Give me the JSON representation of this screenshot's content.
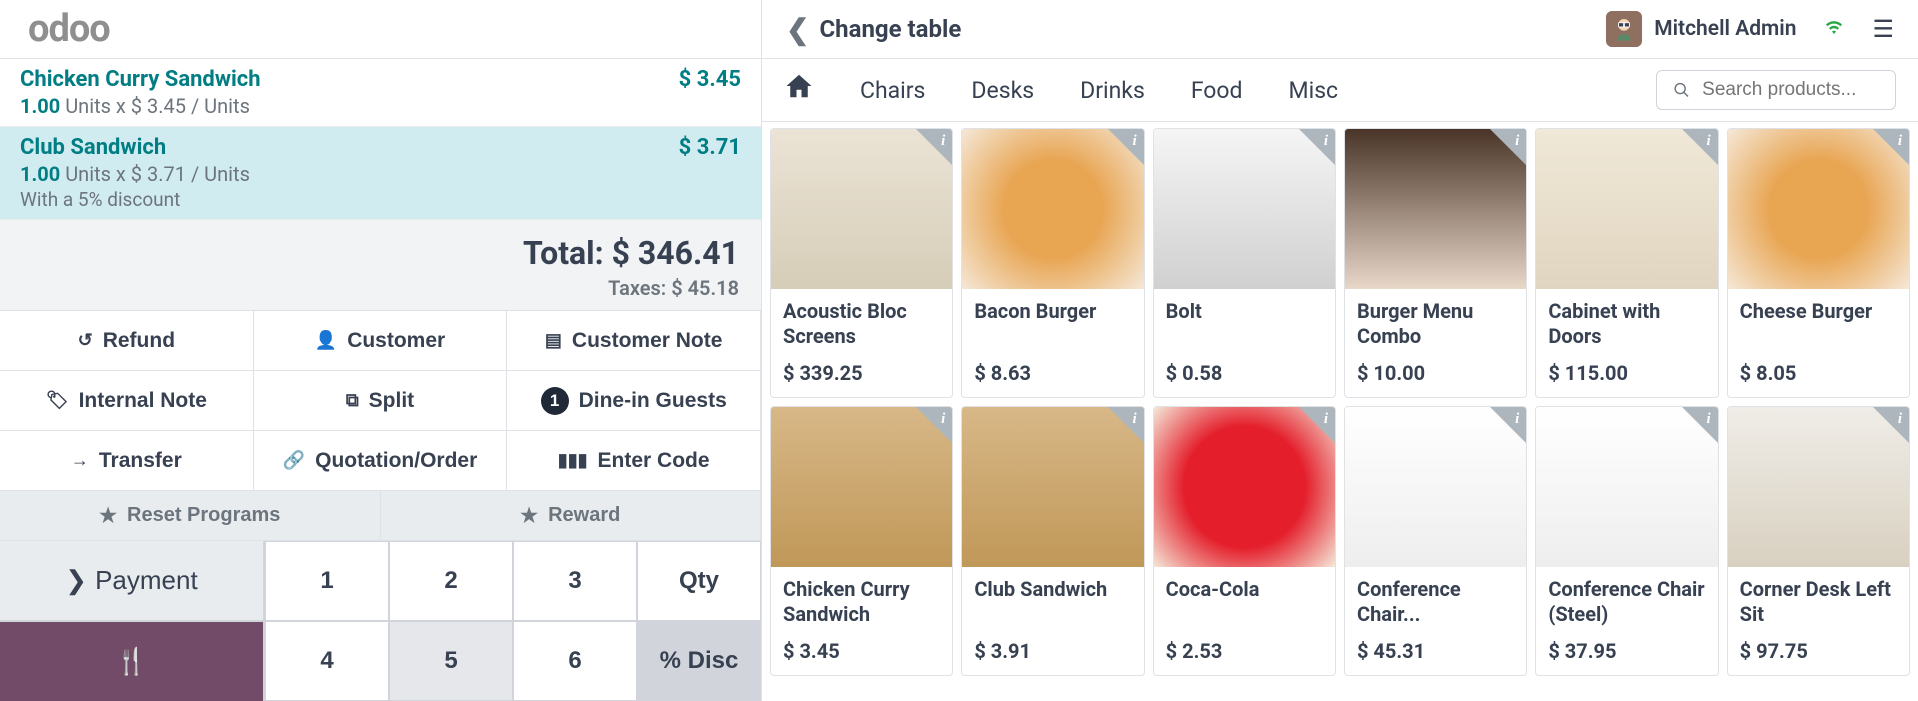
{
  "logo": "odoo",
  "order_lines": [
    {
      "name": "Chicken Curry Sandwich",
      "price": "$ 3.45",
      "qty_bold": "1.00",
      "qty_rest": "Units x $ 3.45 / Units",
      "discount": "",
      "selected": false
    },
    {
      "name": "Club Sandwich",
      "price": "$ 3.71",
      "qty_bold": "1.00",
      "qty_rest": "Units x $ 3.71 / Units",
      "discount": "With a 5% discount",
      "selected": true
    }
  ],
  "totals": {
    "label": "Total: $ 346.41",
    "taxes": "Taxes: $ 45.18"
  },
  "actions": {
    "refund": "Refund",
    "customer": "Customer",
    "customer_note": "Customer Note",
    "internal_note": "Internal Note",
    "split": "Split",
    "guests_badge": "1",
    "guests_label": "Dine-in Guests",
    "transfer": "Transfer",
    "quotation": "Quotation/Order",
    "enter_code": "Enter Code"
  },
  "programs": {
    "reset": "Reset Programs",
    "reward": "Reward"
  },
  "payment": "Payment",
  "numpad": {
    "n1": "1",
    "n2": "2",
    "n3": "3",
    "qty": "Qty",
    "n4": "4",
    "n5": "5",
    "n6": "6",
    "disc": "% Disc"
  },
  "header": {
    "back": "Change table",
    "user": "Mitchell Admin"
  },
  "categories": [
    "Chairs",
    "Desks",
    "Drinks",
    "Food",
    "Misc"
  ],
  "search_placeholder": "Search products...",
  "products_row1": [
    {
      "name": "Acoustic Bloc Screens",
      "price": "$ 339.25",
      "cls": "p-screen"
    },
    {
      "name": "Bacon Burger",
      "price": "$ 8.63",
      "cls": "p-burger"
    },
    {
      "name": "Bolt",
      "price": "$ 0.58",
      "cls": "p-bolt"
    },
    {
      "name": "Burger Menu Combo",
      "price": "$ 10.00",
      "cls": "p-combo"
    },
    {
      "name": "Cabinet with Doors",
      "price": "$ 115.00",
      "cls": "p-cabinet"
    },
    {
      "name": "Cheese Burger",
      "price": "$ 8.05",
      "cls": "p-burger"
    }
  ],
  "products_row2": [
    {
      "name": "Chicken Curry Sandwich",
      "price": "$ 3.45",
      "cls": "p-sandwich"
    },
    {
      "name": "Club Sandwich",
      "price": "$ 3.91",
      "cls": "p-sandwich"
    },
    {
      "name": "Coca-Cola",
      "price": "$ 2.53",
      "cls": "p-coke"
    },
    {
      "name": "Conference Chair...",
      "price": "$ 45.31",
      "cls": "p-chair"
    },
    {
      "name": "Conference Chair (Steel)",
      "price": "$ 37.95",
      "cls": "p-chair"
    },
    {
      "name": "Corner Desk Left Sit",
      "price": "$ 97.75",
      "cls": "p-desk"
    }
  ]
}
